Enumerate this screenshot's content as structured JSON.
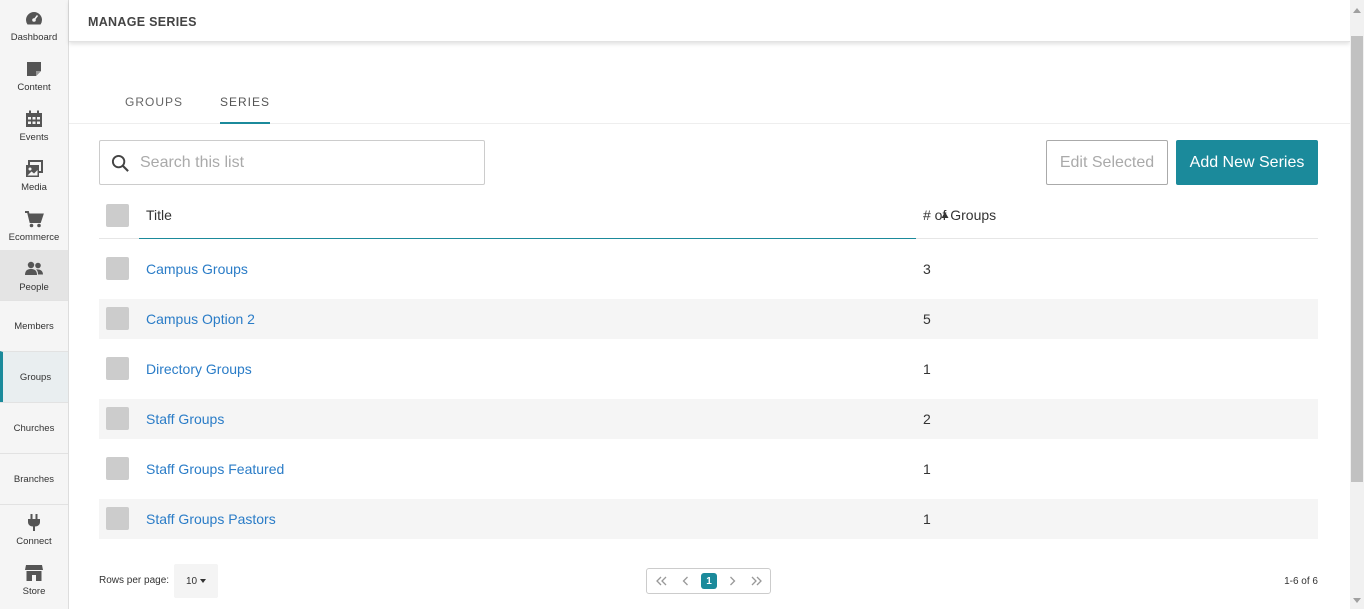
{
  "sidebar": {
    "items": [
      {
        "label": "Dashboard",
        "icon": "dashboard-icon"
      },
      {
        "label": "Content",
        "icon": "content-icon"
      },
      {
        "label": "Events",
        "icon": "calendar-icon"
      },
      {
        "label": "Media",
        "icon": "media-icon"
      },
      {
        "label": "Ecommerce",
        "icon": "cart-icon"
      },
      {
        "label": "People",
        "icon": "people-icon"
      }
    ],
    "subitems": [
      {
        "label": "Members"
      },
      {
        "label": "Groups"
      },
      {
        "label": "Churches"
      },
      {
        "label": "Branches"
      }
    ],
    "bottom": [
      {
        "label": "Connect",
        "icon": "plug-icon"
      },
      {
        "label": "Store",
        "icon": "store-icon"
      }
    ]
  },
  "header": {
    "title": "MANAGE SERIES"
  },
  "tabs": [
    {
      "label": "GROUPS"
    },
    {
      "label": "SERIES"
    }
  ],
  "toolbar": {
    "search_placeholder": "Search this list",
    "edit_label": "Edit Selected",
    "add_label": "Add New Series"
  },
  "table": {
    "columns": [
      "Title",
      "# of Groups"
    ],
    "rows": [
      {
        "title": "Campus Groups",
        "count": "3"
      },
      {
        "title": "Campus Option 2",
        "count": "5"
      },
      {
        "title": "Directory Groups",
        "count": "1"
      },
      {
        "title": "Staff Groups",
        "count": "2"
      },
      {
        "title": "Staff Groups Featured",
        "count": "1"
      },
      {
        "title": "Staff Groups Pastors",
        "count": "1"
      }
    ]
  },
  "footer": {
    "rows_per_page_label": "Rows per page:",
    "rows_per_page_value": "10",
    "current_page": "1",
    "range": "1-6 of 6"
  },
  "colors": {
    "accent": "#1b8a9b",
    "link": "#2a7cc7"
  }
}
